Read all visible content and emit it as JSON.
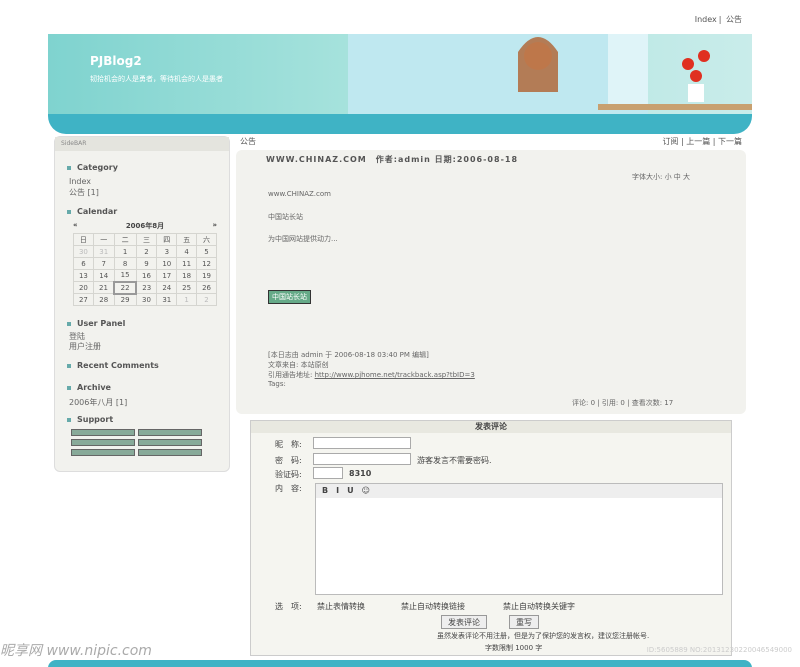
{
  "topnav": {
    "items": [
      "Index",
      "公告"
    ]
  },
  "banner": {
    "title": "PJBlog2",
    "slogan": "韧拾机会的人是勇者，等待机会的人是愚者"
  },
  "sidebar": {
    "title": "SideBAR",
    "category": {
      "heading": "Category",
      "items": [
        "Index",
        "公告 [1]"
      ]
    },
    "calendar": {
      "heading": "Calendar",
      "month": "2006年8月",
      "prev": "«",
      "next": "»",
      "weekdays": [
        "日",
        "一",
        "二",
        "三",
        "四",
        "五",
        "六"
      ],
      "rows": [
        [
          "30",
          "31",
          "1",
          "2",
          "3",
          "4",
          "5"
        ],
        [
          "6",
          "7",
          "8",
          "9",
          "10",
          "11",
          "12"
        ],
        [
          "13",
          "14",
          "15",
          "16",
          "17",
          "18",
          "19"
        ],
        [
          "20",
          "21",
          "22",
          "23",
          "24",
          "25",
          "26"
        ],
        [
          "27",
          "28",
          "29",
          "30",
          "31",
          "1",
          "2"
        ]
      ]
    },
    "user_panel": {
      "heading": "User Panel",
      "items": [
        "登陆",
        "用户注册"
      ]
    },
    "recent_comments": {
      "heading": "Recent Comments"
    },
    "archive": {
      "heading": "Archive",
      "items": [
        "2006年八月 [1]"
      ]
    },
    "support": {
      "heading": "Support"
    }
  },
  "post": {
    "category": "公告",
    "nav": {
      "subscribe": "订阅",
      "prev": "上一篇",
      "next": "下一篇"
    },
    "title": "WWW.CHINAZ.COM",
    "meta": "作者:admin 日期:2006-08-18",
    "font_size": "字体大小: 小 中 大",
    "lines": [
      "www.CHINAZ.com",
      "中国站长站",
      "为中国网站提供动力..."
    ],
    "image_label": "中国站长站",
    "edit_note": "[本日志由 admin 于 2006-08-18 03:40 PM 编辑]",
    "source_label": "文章来自:",
    "source_value": "本站原创",
    "trackback_label": "引用通告地址:",
    "trackback_url": "http://www.pjhome.net/trackback.asp?tbID=3",
    "tags": "Tags:",
    "stats": "评论: 0 | 引用: 0 | 查看次数: 17"
  },
  "comment": {
    "title": "发表评论",
    "nickname": "昵　称:",
    "password": "密　码:",
    "guest_note": "游客发言不需要密码.",
    "captcha": "验证码:",
    "captcha_value": "8310",
    "content": "内　容:",
    "options": "选　项:",
    "opt1": "禁止表情转换",
    "opt2": "禁止自动转换链接",
    "opt3": "禁止自动转换关键字",
    "submit": "发表评论",
    "reset": "重写",
    "note": "虽然发表评论不用注册，但是为了保护您的发言权，建议您注册帐号.",
    "limit": "字数限制 1000 字"
  },
  "watermark": {
    "left": "昵享网 www.nipic.com",
    "right": "ID:5605889 NO:20131230220046549000"
  }
}
